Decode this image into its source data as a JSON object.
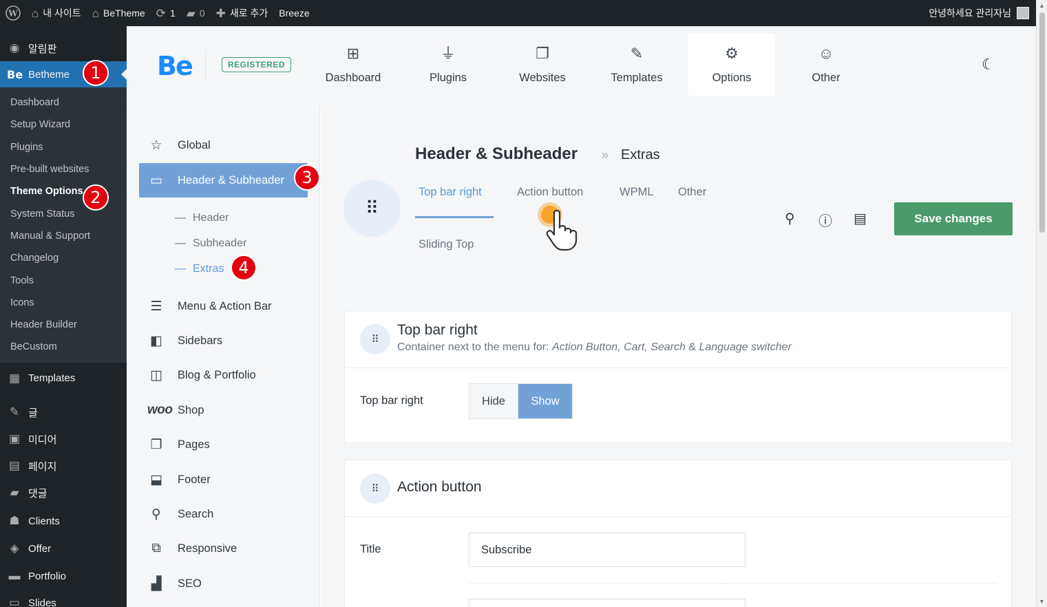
{
  "adminbar": {
    "site_name": "내 사이트",
    "theme_link": "BeTheme",
    "updates_count": "1",
    "comments_count": "0",
    "new_label": "새로 추가",
    "breeze_label": "Breeze",
    "greeting": "안녕하세요 관리자님"
  },
  "wpmenu": {
    "dashboard": "알림판",
    "betheme": "Betheme",
    "betheme_icon": "Be",
    "submenu": [
      "Dashboard",
      "Setup Wizard",
      "Plugins",
      "Pre-built websites",
      "Theme Options",
      "System Status",
      "Manual & Support",
      "Changelog",
      "Tools",
      "Icons",
      "Header Builder",
      "BeCustom"
    ],
    "items_after": [
      "Templates",
      "글",
      "미디어",
      "페이지",
      "댓글",
      "Clients",
      "Offer",
      "Portfolio",
      "Slides"
    ]
  },
  "badges": [
    "1",
    "2",
    "3",
    "4"
  ],
  "topnav": {
    "logo": "Be",
    "registered": "REGISTERED",
    "items": [
      "Dashboard",
      "Plugins",
      "Websites",
      "Templates",
      "Options",
      "Other"
    ],
    "active": "Options"
  },
  "optnav": {
    "global": "Global",
    "header": "Header & Subheader",
    "sub": [
      "Header",
      "Subheader",
      "Extras"
    ],
    "items": [
      "Menu & Action Bar",
      "Sidebars",
      "Blog & Portfolio",
      "Shop",
      "Pages",
      "Footer",
      "Search",
      "Responsive",
      "SEO"
    ],
    "woo_icon": "woo"
  },
  "main": {
    "crumb_title": "Header & Subheader",
    "crumb_sep": "»",
    "crumb_current": "Extras",
    "tabs": [
      "Top bar right",
      "Action button",
      "WPML",
      "Other",
      "Sliding Top"
    ],
    "active_tab": "Top bar right",
    "save_label": "Save changes"
  },
  "cards": {
    "topbar": {
      "title": "Top bar right",
      "desc_prefix": "Container next to the menu for: ",
      "desc_items": "Action Button, Cart, Search",
      "desc_amp": " & ",
      "desc_last": "Language switcher",
      "field_label": "Top bar right",
      "hide": "Hide",
      "show": "Show",
      "selected": "Show"
    },
    "action": {
      "title": "Action button",
      "field_label": "Title",
      "title_value": "Subscribe"
    }
  },
  "colors": {
    "wp_blue": "#2271b1",
    "accent_blue": "#72a1d8",
    "save_green": "#4a9a6a",
    "badge_red": "#e3000f",
    "logo_blue": "#1a8cff"
  }
}
